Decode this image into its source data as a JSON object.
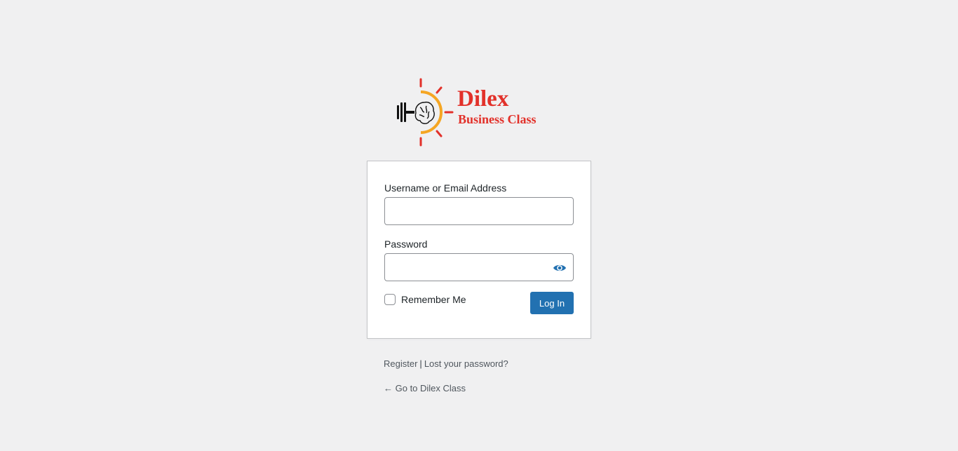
{
  "logo": {
    "title": "Dilex",
    "subtitle": "Business Class",
    "icon": "lightbulb-brain-dumbbell-icon",
    "colors": {
      "brand_red": "#e2312a",
      "accent_orange": "#f5a623",
      "dark": "#111111"
    }
  },
  "form": {
    "username_label": "Username or Email Address",
    "username_value": "",
    "password_label": "Password",
    "password_value": "",
    "show_password_icon": "eye-icon",
    "remember_label": "Remember Me",
    "remember_checked": false,
    "submit_label": "Log In"
  },
  "links": {
    "register": "Register",
    "separator": "|",
    "lost_password": "Lost your password?",
    "back": "← Go to Dilex Class"
  },
  "colors": {
    "background": "#f0f0f1",
    "primary_button": "#2271b1",
    "eye_icon": "#2271b1"
  }
}
